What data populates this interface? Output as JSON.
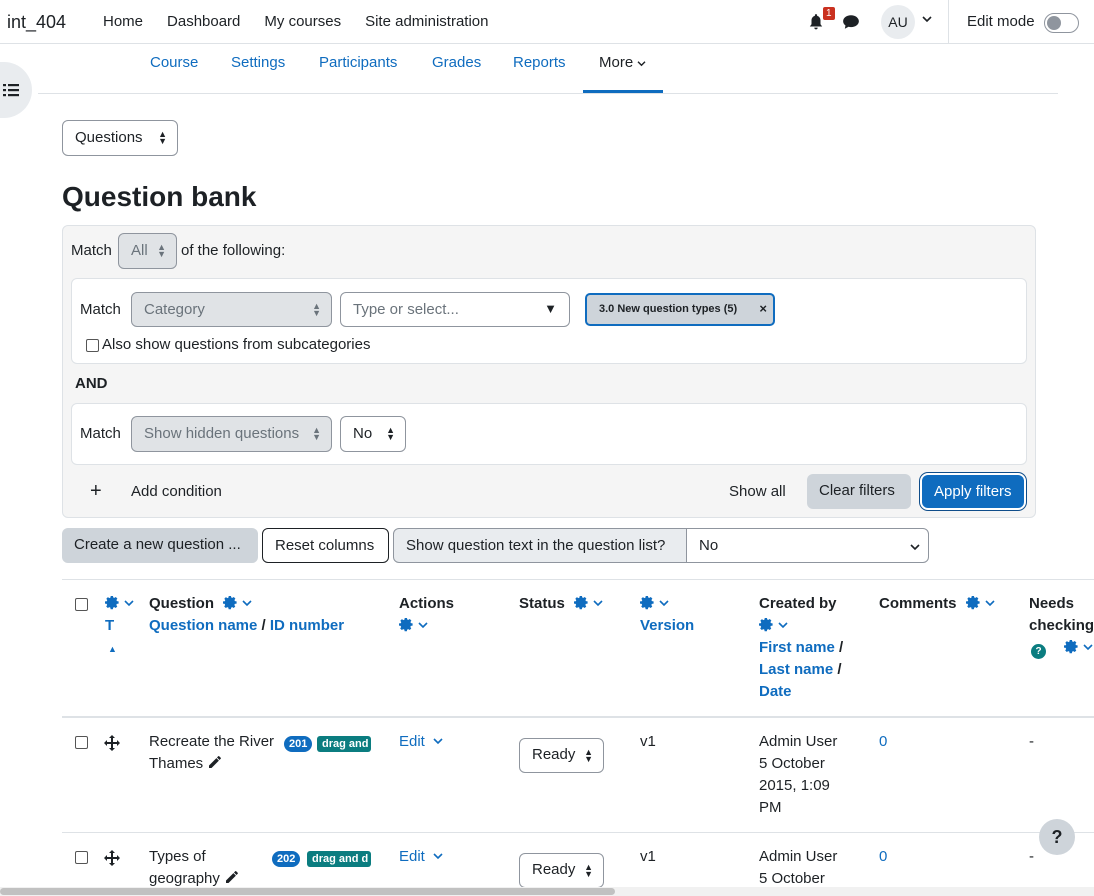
{
  "navbar": {
    "brand": "int_404",
    "links": [
      "Home",
      "Dashboard",
      "My courses",
      "Site administration"
    ],
    "notification_count": "1",
    "avatar_initials": "AU",
    "edit_mode_label": "Edit mode",
    "edit_mode_on": false
  },
  "secondary_nav": {
    "items": [
      "Course",
      "Settings",
      "Participants",
      "Grades",
      "Reports"
    ],
    "more_label": "More",
    "active": "More"
  },
  "page": {
    "nav_select": "Questions",
    "title": "Question bank"
  },
  "filters": {
    "match_label": "Match",
    "match_value": "All",
    "of_following": "of the following:",
    "condition1": {
      "match_label": "Match",
      "field": "Category",
      "input_placeholder": "Type or select...",
      "chip": "3.0 New question types (5)",
      "subcategories_label": "Also show questions from subcategories",
      "subcategories_checked": false
    },
    "and_label": "AND",
    "condition2": {
      "match_label": "Match",
      "field": "Show hidden questions",
      "value": "No"
    },
    "add_condition": "Add condition",
    "show_all": "Show all",
    "clear_filters": "Clear filters",
    "apply_filters": "Apply filters"
  },
  "toolbar": {
    "create_new": "Create a new question ...",
    "reset_columns": "Reset columns",
    "show_text_label": "Show question text in the question list?",
    "show_text_value": "No"
  },
  "table": {
    "headers": {
      "t": "T",
      "question": "Question",
      "question_name": "Question name",
      "slash1": " / ",
      "id_number": "ID number",
      "actions": "Actions",
      "status": "Status",
      "version": "Version",
      "created_by": "Created by",
      "first_name": "First name",
      "last_name": "Last name",
      "date": "Date",
      "slash": " /",
      "comments": "Comments",
      "needs_checking_1": "Needs",
      "needs_checking_2": "checking"
    },
    "rows": [
      {
        "name_line1": "Recreate the River",
        "name_line2": "Thames",
        "id": "201",
        "tag": "drag and",
        "action": "Edit",
        "status": "Ready",
        "version": "v1",
        "created_line1": "Admin User",
        "created_line2": "5 October",
        "created_line3": "2015, 1:09",
        "created_line4": "PM",
        "comments": "0",
        "needs_checking": "-"
      },
      {
        "name_line1": "Types of",
        "name_line2": "geography",
        "id": "202",
        "tag": "drag and d",
        "action": "Edit",
        "status": "Ready",
        "version": "v1",
        "created_line1": "Admin User",
        "created_line2": "5 October",
        "comments": "0",
        "needs_checking": "-"
      }
    ]
  },
  "help_label": "?",
  "colors": {
    "primary": "#0f6cbf",
    "tag": "#0b7d80",
    "badge_red": "#ca3120"
  }
}
